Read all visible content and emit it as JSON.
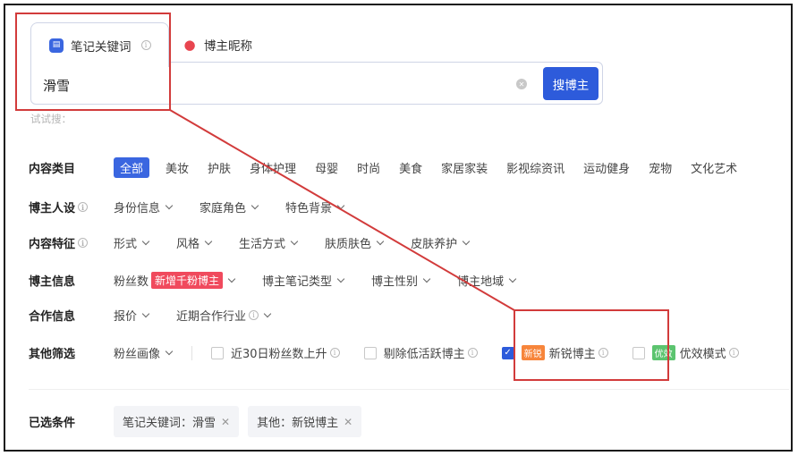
{
  "tabs": [
    {
      "label": "笔记关键词",
      "icon": "note-icon"
    },
    {
      "label": "博主昵称",
      "icon": "person-icon"
    }
  ],
  "search": {
    "value": "滑雪",
    "button_label": "搜博主",
    "try_text": "试试搜："
  },
  "filters": {
    "content_category": {
      "label": "内容类目",
      "options": [
        "全部",
        "美妆",
        "护肤",
        "身体护理",
        "母婴",
        "时尚",
        "美食",
        "家居家装",
        "影视综资讯",
        "运动健身",
        "宠物",
        "文化艺术"
      ],
      "selected": "全部"
    },
    "persona": {
      "label": "博主人设",
      "dropdowns": [
        "身份信息",
        "家庭角色",
        "特色背景"
      ]
    },
    "content_features": {
      "label": "内容特征",
      "dropdowns": [
        "形式",
        "风格",
        "生活方式",
        "肤质肤色",
        "皮肤养护"
      ]
    },
    "blogger_info": {
      "label": "博主信息",
      "fans_label": "粉丝数",
      "fans_badge": "新增千粉博主",
      "dropdowns": [
        "博主笔记类型",
        "博主性别",
        "博主地域"
      ]
    },
    "cooperation": {
      "label": "合作信息",
      "dropdowns": [
        "报价",
        "近期合作行业"
      ]
    },
    "other": {
      "label": "其他筛选",
      "dropdown": "粉丝画像",
      "checkboxes": [
        {
          "label": "近30日粉丝数上升",
          "checked": false,
          "tag": ""
        },
        {
          "label": "剔除低活跃博主",
          "checked": false,
          "tag": ""
        },
        {
          "label": "新锐博主",
          "checked": true,
          "tag": "新锐"
        },
        {
          "label": "优效模式",
          "checked": false,
          "tag": "优效"
        }
      ]
    }
  },
  "selected_conditions": {
    "label": "已选条件",
    "chips": [
      "笔记关键词：滑雪",
      "其他：新锐博主"
    ]
  },
  "colors": {
    "primary": "#2d5bdb",
    "annotation": "#d23b3b",
    "badge_red": "#f04a5d"
  }
}
